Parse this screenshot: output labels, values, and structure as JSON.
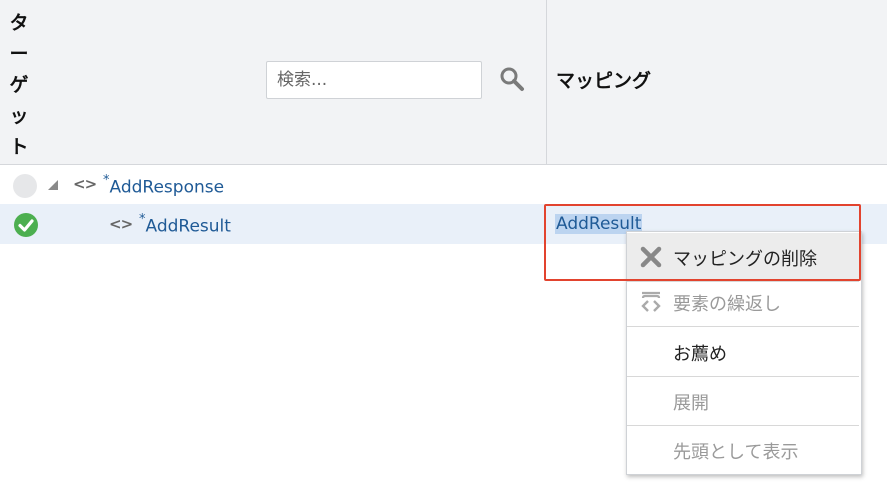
{
  "header": {
    "target_title_chars": [
      "タ",
      "ー",
      "ゲ",
      "ッ",
      "ト"
    ],
    "search_placeholder": "検索...",
    "mapping_title": "マッピング"
  },
  "tree": {
    "rows": [
      {
        "name": "AddResponse",
        "required_marker": "*",
        "status": "none",
        "expanded": true
      },
      {
        "name": "AddResult",
        "required_marker": "*",
        "status": "mapped",
        "mapping": "AddResult"
      }
    ]
  },
  "context_menu": {
    "items": [
      {
        "label": "マッピングの削除",
        "icon": "close-x-icon",
        "enabled": true,
        "selected": true
      },
      {
        "label": "要素の繰返し",
        "icon": "repeat-element-icon",
        "enabled": false
      },
      {
        "label": "お薦め",
        "icon": "",
        "enabled": true
      },
      {
        "label": "展開",
        "icon": "",
        "enabled": false
      },
      {
        "label": "先頭として表示",
        "icon": "",
        "enabled": false
      }
    ]
  },
  "colors": {
    "header_bg": "#f2f3f5",
    "link_blue": "#1f5a96",
    "selection_bg": "#bcd4f0",
    "highlight_red": "#e2432e",
    "status_green": "#4caf50"
  }
}
